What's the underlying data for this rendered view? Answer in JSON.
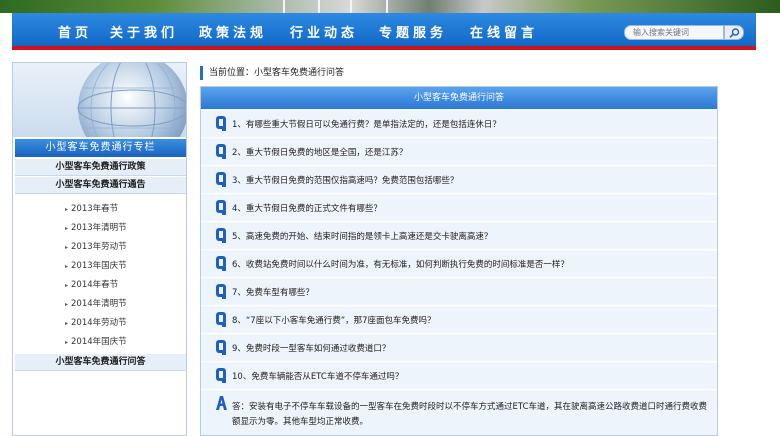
{
  "nav": {
    "items": [
      "首页",
      "关于我们",
      "政策法规",
      "行业动态",
      "专题服务",
      "在线留言"
    ],
    "search_placeholder": "输入搜索关键词"
  },
  "sidebar": {
    "title": "小型客车免费通行专栏",
    "categories": [
      "小型客车免费通行政策",
      "小型客车免费通行通告",
      "小型客车免费通行问答"
    ],
    "notice_items": [
      "2013年春节",
      "2013年清明节",
      "2013年劳动节",
      "2013年国庆节",
      "2014年春节",
      "2014年清明节",
      "2014年劳动节",
      "2014年国庆节"
    ]
  },
  "breadcrumb": "当前位置：小型客车免费通行问答",
  "panel": {
    "title": "小型客车免费通行问答",
    "questions": [
      "1、有哪些重大节假日可以免通行费？是单指法定的，还是包括连休日？",
      "2、重大节假日免费的地区是全国，还是江苏？",
      "3、重大节假日免费的范围仅指高速吗？免费范围包括哪些？",
      "4、重大节假日免费的正式文件有哪些？",
      "5、高速免费的开始、结束时间指的是领卡上高速还是交卡驶离高速？",
      "6、收费站免费时间以什么时间为准，有无标准，如何判断执行免费的时间标准是否一样？",
      "7、免费车型有哪些？",
      "8、“7座以下小客车免通行费”，那7座面包车免费吗？",
      "9、免费时段一型客车如何通过收费道口？",
      "10、免费车辆能否从ETC车道不停车通过吗？"
    ],
    "answer": "答：安装有电子不停车车载设备的一型客车在免费时段时以不停车方式通过ETC车道，其在驶离高速公路收费道口时通行费收费额显示为零。其他车型均正常收费。"
  },
  "colors": {
    "nav_blue": "#1a74d2",
    "nav_red_line": "#d0141a",
    "panel_bg": "#eef4fb",
    "q_icon_blue": "#1f5fc0"
  }
}
